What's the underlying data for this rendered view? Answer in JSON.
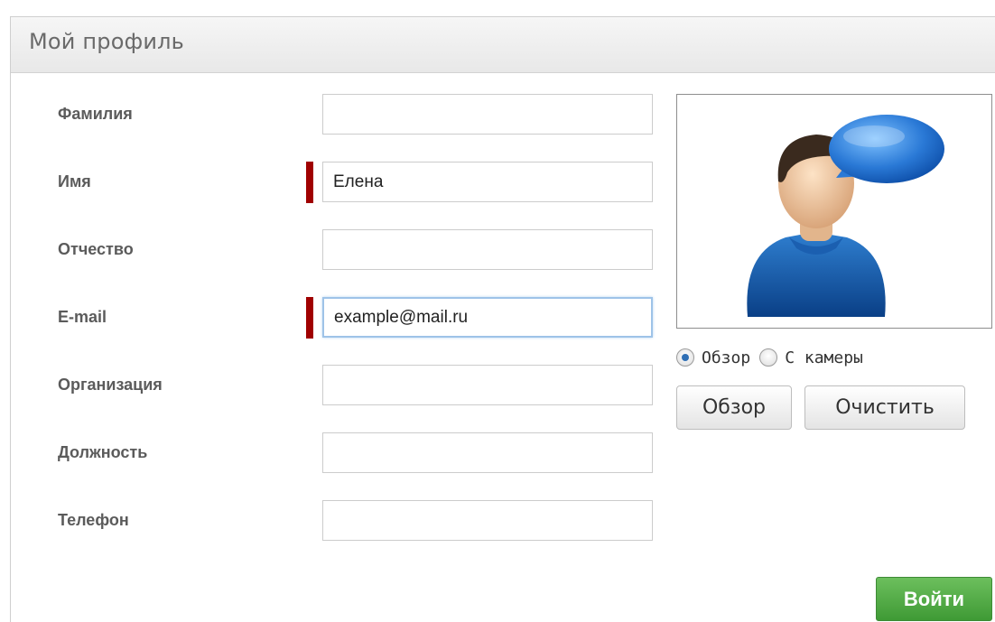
{
  "panel": {
    "title": "Мой профиль"
  },
  "form": {
    "fields": [
      {
        "label": "Фамилия",
        "value": "",
        "required": false
      },
      {
        "label": "Имя",
        "value": "Елена",
        "required": true
      },
      {
        "label": "Отчество",
        "value": "",
        "required": false
      },
      {
        "label": "E-mail",
        "value": "example@mail.ru",
        "required": true,
        "focused": true
      },
      {
        "label": "Организация",
        "value": "",
        "required": false
      },
      {
        "label": "Должность",
        "value": "",
        "required": false
      },
      {
        "label": "Телефон",
        "value": "",
        "required": false
      }
    ]
  },
  "photo": {
    "icon": "user-avatar-with-speech-bubble-icon",
    "source_options": [
      {
        "label": "Обзор",
        "checked": true
      },
      {
        "label": "С камеры",
        "checked": false
      }
    ],
    "browse_label": "Обзор",
    "clear_label": "Очистить"
  },
  "actions": {
    "login_label": "Войти"
  },
  "colors": {
    "required_marker": "#a00000",
    "login_button": "#4ea843",
    "focus_border": "#9ec3e8"
  }
}
